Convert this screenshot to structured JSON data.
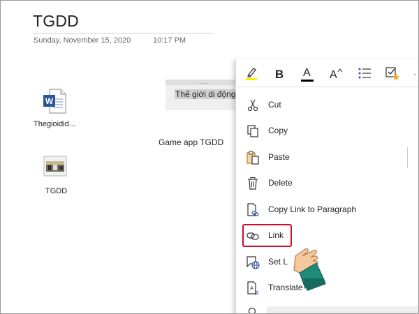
{
  "page": {
    "title": "TGDD",
    "date": "Sunday, November 15, 2020",
    "time": "10:17 PM"
  },
  "canvas": {
    "files": [
      {
        "label": "Thegioidid...",
        "icon": "word-document-icon"
      },
      {
        "label": "TGDD",
        "icon": "image-file-icon"
      }
    ],
    "note_handle": "....",
    "note_text": "Thế giới di động",
    "text_block": "Game app TGDD"
  },
  "context_menu": {
    "toolbar": [
      {
        "name": "highlight",
        "icon": "highlighter-icon"
      },
      {
        "name": "bold",
        "label": "B",
        "icon": "bold-icon"
      },
      {
        "name": "font-color",
        "label": "A",
        "icon": "font-color-icon"
      },
      {
        "name": "font-size",
        "label": "A",
        "icon": "font-size-icon"
      },
      {
        "name": "bullets",
        "icon": "bullet-list-icon"
      },
      {
        "name": "tag",
        "icon": "todo-tag-icon"
      }
    ],
    "more": "·",
    "items": [
      {
        "label": "Cut",
        "icon": "scissors-icon"
      },
      {
        "label": "Copy",
        "icon": "copy-icon"
      },
      {
        "label": "Paste",
        "icon": "paste-icon"
      },
      {
        "label": "Delete",
        "icon": "trash-icon"
      },
      {
        "label": "Copy Link to Paragraph",
        "icon": "copy-link-icon"
      },
      {
        "label": "Link",
        "icon": "link-icon"
      },
      {
        "label": "Set L",
        "icon": "set-language-icon"
      },
      {
        "label": "Translate",
        "icon": "translate-icon"
      }
    ]
  },
  "colors": {
    "highlight_marker": "#ffef00",
    "font_color_bar": "#000000",
    "accent": "#2b5797",
    "callout_border": "#c8102e"
  }
}
